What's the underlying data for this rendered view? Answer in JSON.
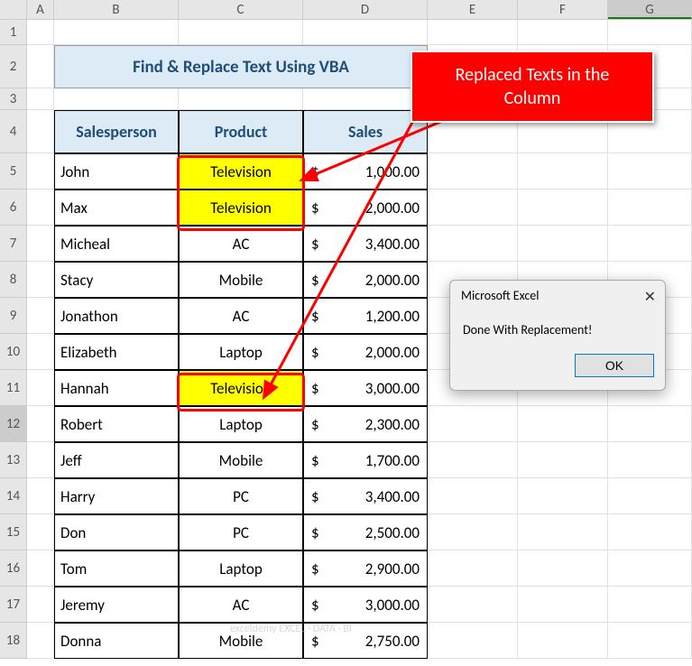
{
  "columns": [
    "A",
    "B",
    "C",
    "D",
    "E",
    "F",
    "G"
  ],
  "rows": [
    "1",
    "2",
    "3",
    "4",
    "5",
    "6",
    "7",
    "8",
    "9",
    "10",
    "11",
    "12",
    "13",
    "14",
    "15",
    "16",
    "17",
    "18"
  ],
  "title": "Find & Replace Text Using VBA",
  "headers": {
    "salesperson": "Salesperson",
    "product": "Product",
    "sales": "Sales"
  },
  "currency": "$",
  "table": [
    {
      "sp": "John",
      "prod": "Television",
      "sales": "1,000.00",
      "hl": true
    },
    {
      "sp": "Max",
      "prod": "Television",
      "sales": "2,000.00",
      "hl": true
    },
    {
      "sp": "Micheal",
      "prod": "AC",
      "sales": "3,400.00",
      "hl": false
    },
    {
      "sp": "Stacy",
      "prod": "Mobile",
      "sales": "2,000.00",
      "hl": false
    },
    {
      "sp": "Jonathon",
      "prod": "AC",
      "sales": "1,200.00",
      "hl": false
    },
    {
      "sp": "Elizabeth",
      "prod": "Laptop",
      "sales": "2,000.00",
      "hl": false
    },
    {
      "sp": "Hannah",
      "prod": "Television",
      "sales": "3,000.00",
      "hl": true
    },
    {
      "sp": "Robert",
      "prod": "Laptop",
      "sales": "2,300.00",
      "hl": false
    },
    {
      "sp": "Jeff",
      "prod": "Mobile",
      "sales": "1,700.00",
      "hl": false
    },
    {
      "sp": "Harry",
      "prod": "PC",
      "sales": "3,400.00",
      "hl": false
    },
    {
      "sp": "Don",
      "prod": "PC",
      "sales": "2,500.00",
      "hl": false
    },
    {
      "sp": "Tom",
      "prod": "Laptop",
      "sales": "2,900.00",
      "hl": false
    },
    {
      "sp": "Jeremy",
      "prod": "AC",
      "sales": "3,000.00",
      "hl": false
    },
    {
      "sp": "Donna",
      "prod": "Mobile",
      "sales": "2,750.00",
      "hl": false
    }
  ],
  "callout": "Replaced Texts in the Column",
  "msgbox": {
    "title": "Microsoft Excel",
    "body": "Done With Replacement!",
    "ok": "OK"
  },
  "watermark": "exceldemy  EXCEL · DATA · BI"
}
